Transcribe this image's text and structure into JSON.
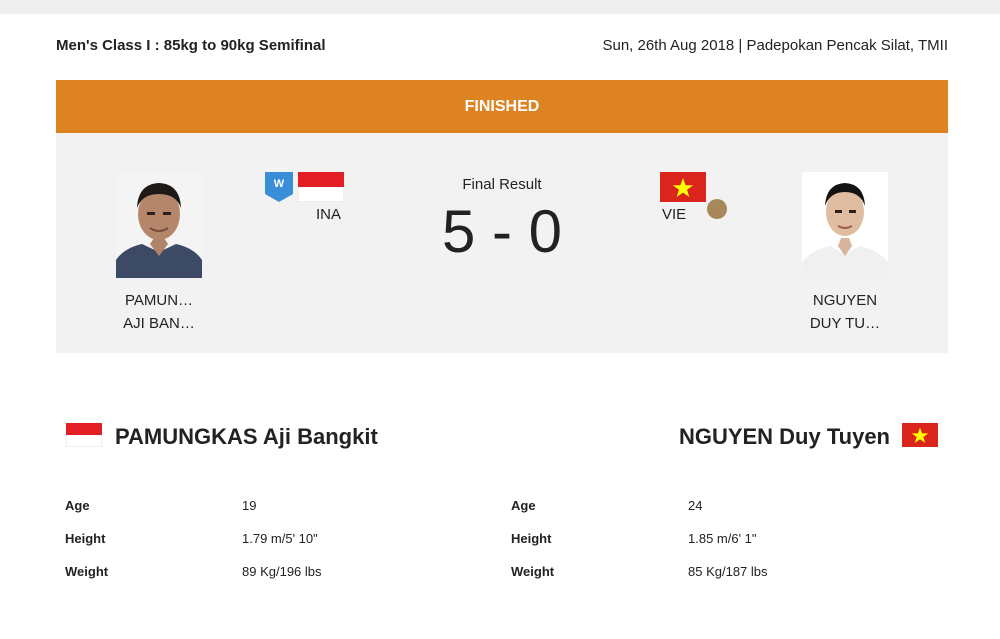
{
  "event": {
    "title": "Men's Class I : 85kg to 90kg Semifinal",
    "info": "Sun, 26th Aug 2018 | Padepokan Pencak Silat, TMII"
  },
  "status": "FINISHED",
  "result": {
    "label": "Final Result",
    "score": "5 - 0"
  },
  "winner_badge": "W",
  "colors": {
    "status_bar": "#dd8321",
    "panel": "#f2f2f2",
    "medal_bronze": "#a8885a",
    "badge_blue": "#3a8ed8",
    "ina_red": "#e31e24",
    "vie_red": "#da251d",
    "vie_star": "#ffff00"
  },
  "athlete_left": {
    "short_name_line1": "PAMUN…",
    "short_name_line2": "AJI BAN…",
    "country_code": "INA",
    "full_name": "PAMUNGKAS Aji Bangkit",
    "stats": [
      {
        "label": "Age",
        "value": "19"
      },
      {
        "label": "Height",
        "value": "1.79 m/5' 10\""
      },
      {
        "label": "Weight",
        "value": "89 Kg/196 lbs"
      }
    ]
  },
  "athlete_right": {
    "short_name_line1": "NGUYEN",
    "short_name_line2": "DUY TU…",
    "country_code": "VIE",
    "full_name": "NGUYEN Duy Tuyen",
    "stats": [
      {
        "label": "Age",
        "value": "24"
      },
      {
        "label": "Height",
        "value": "1.85 m/6' 1\""
      },
      {
        "label": "Weight",
        "value": "85 Kg/187 lbs"
      }
    ]
  }
}
